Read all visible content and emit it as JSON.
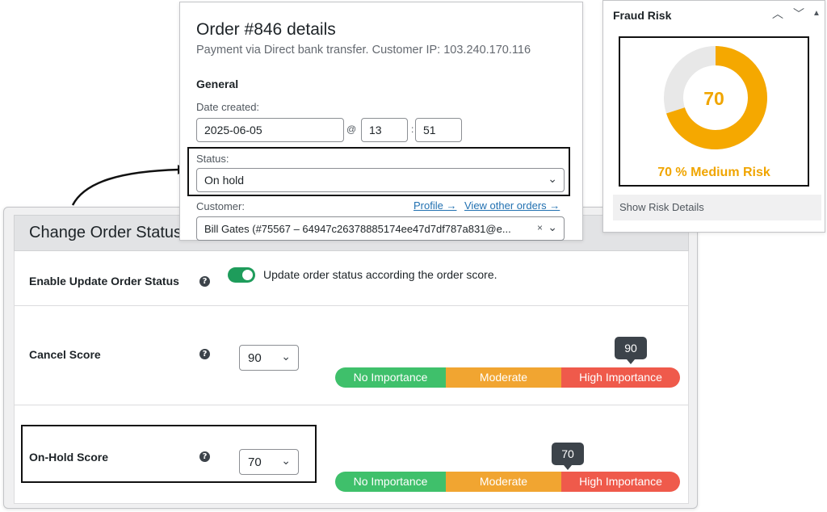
{
  "order": {
    "title": "Order #846 details",
    "subtitle": "Payment via Direct bank transfer. Customer IP: 103.240.170.116",
    "general_heading": "General",
    "date_created_label": "Date created:",
    "date_value": "2025-06-05",
    "at_sign": "@",
    "hour_value": "13",
    "colon": ":",
    "minute_value": "51",
    "status_label": "Status:",
    "status_value": "On hold",
    "customer_label": "Customer:",
    "profile_link": "Profile →",
    "view_orders_link": "View other orders →",
    "customer_value": "Bill Gates (#75567 – 64947c26378885174ee47d7df787a831@e...",
    "clear_symbol": "×"
  },
  "fraud": {
    "title": "Fraud Risk",
    "score": "70",
    "score_fraction": 0.7,
    "risk_label": "70 % Medium Risk",
    "show_details": "Show Risk Details",
    "gauge_color": "#f5a800",
    "track_color": "#e8e8e8"
  },
  "settings": {
    "title": "Change Order Status",
    "enable_label": "Enable Update Order Status",
    "enable_description": "Update order status according the order score.",
    "enable_on": true,
    "cancel_label": "Cancel Score",
    "cancel_value": "90",
    "cancel_tooltip": "90",
    "onhold_label": "On-Hold Score",
    "onhold_value": "70",
    "onhold_tooltip": "70",
    "help_symbol": "?",
    "importance": {
      "low": "No Importance",
      "mid": "Moderate",
      "high": "High Importance"
    }
  },
  "colors": {
    "accent_green": "#1e9c5b",
    "bar_green": "#3fc06b",
    "bar_orange": "#f1a531",
    "bar_red": "#ef5a4b",
    "link_blue": "#2271b1"
  }
}
